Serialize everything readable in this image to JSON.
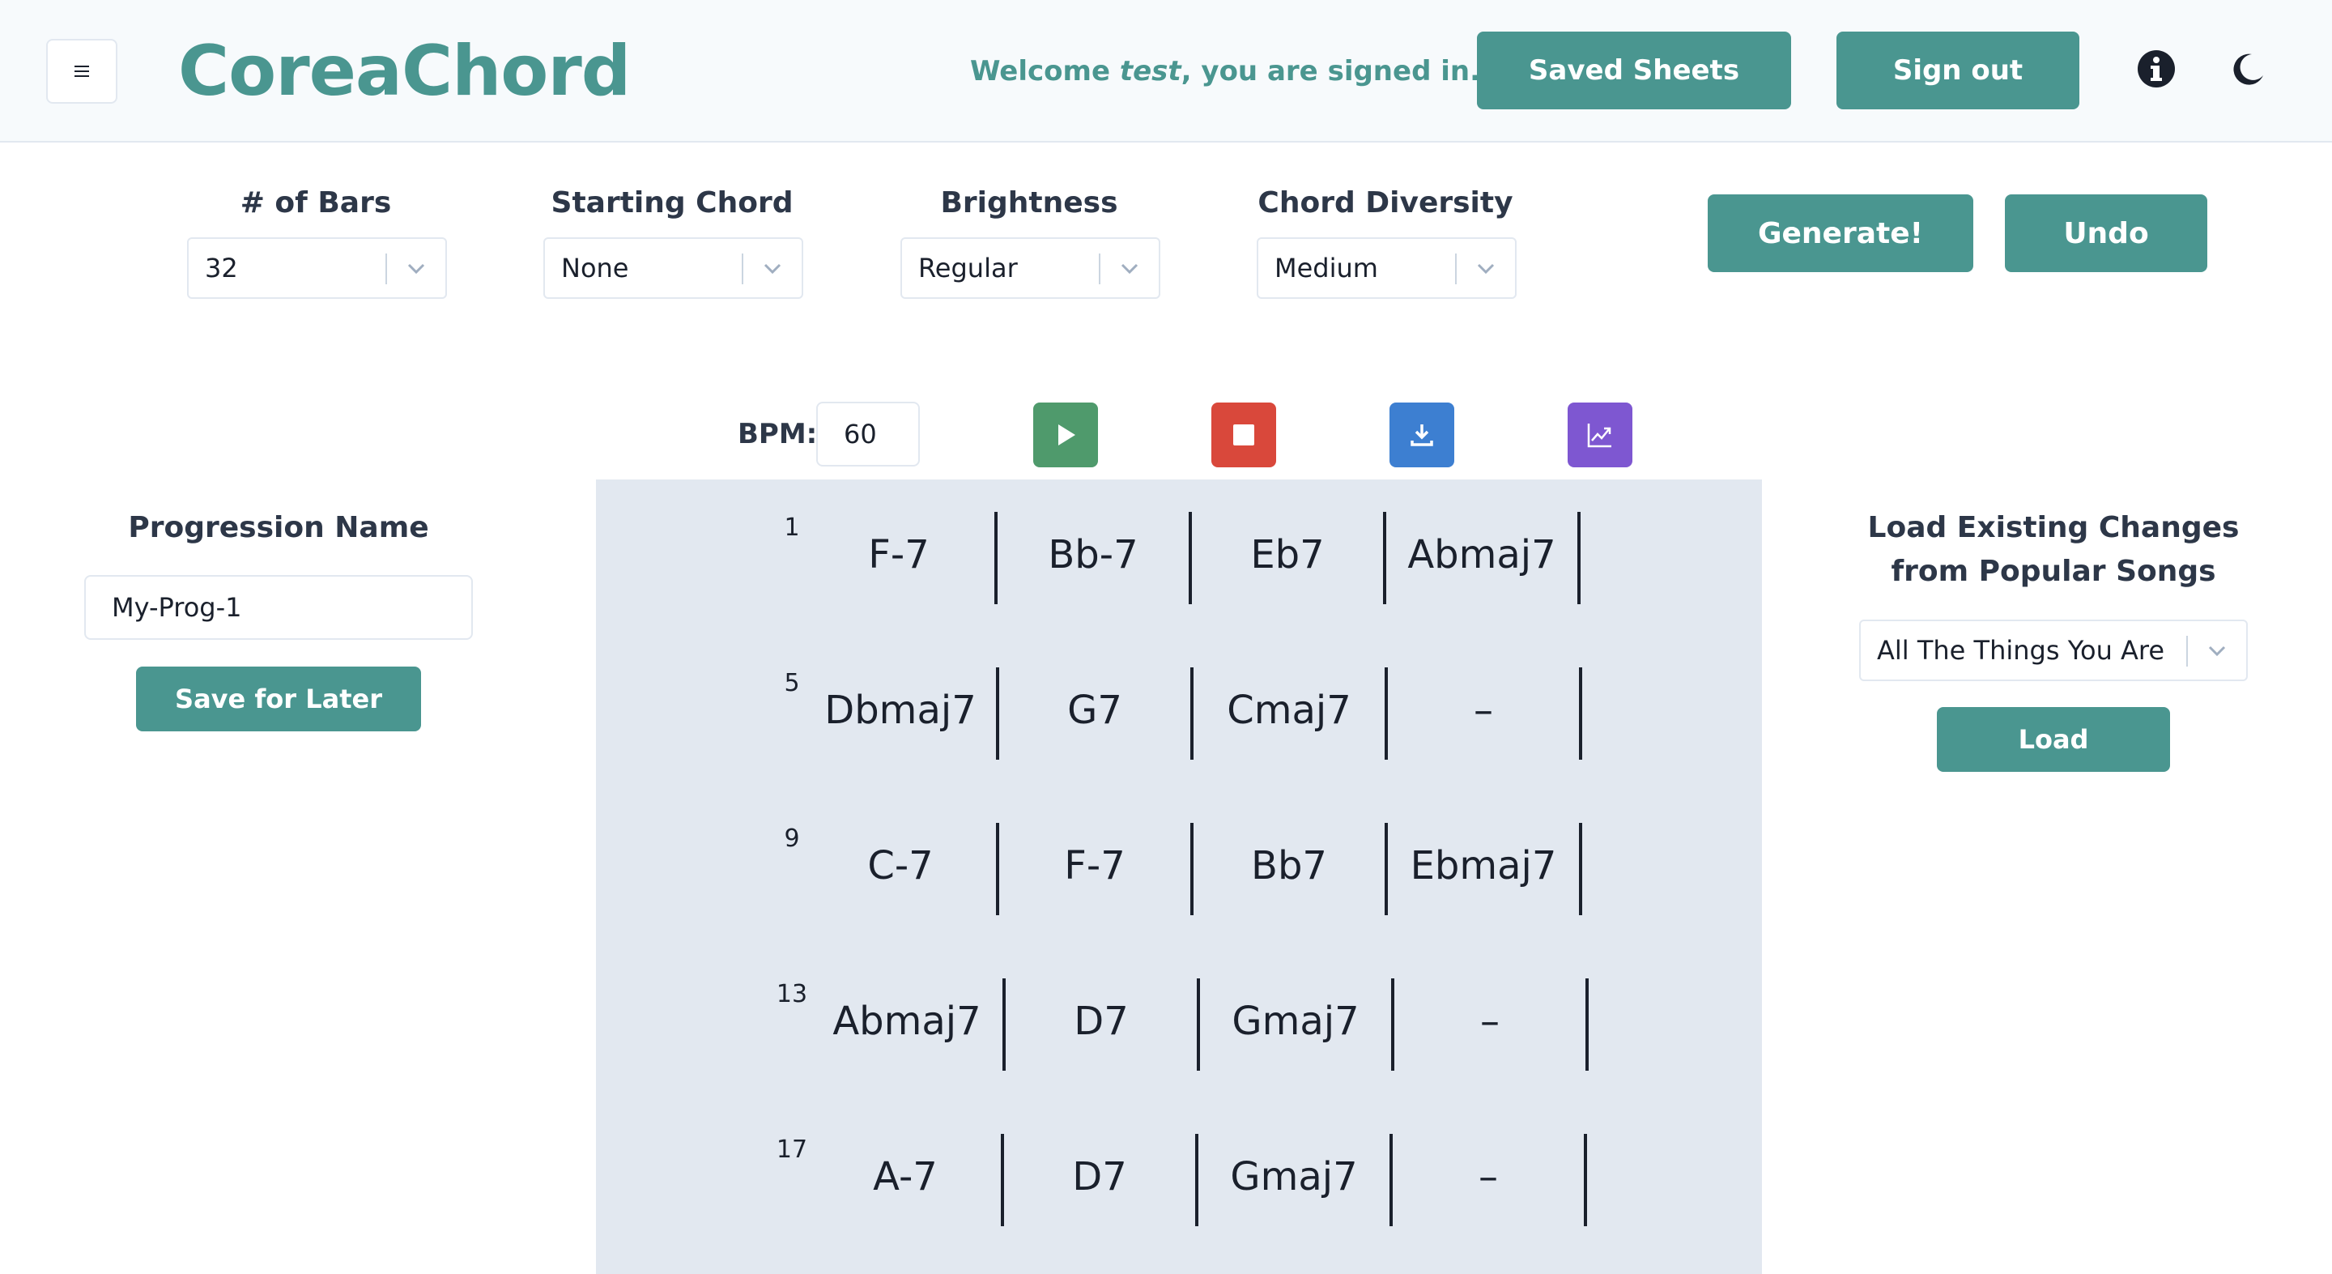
{
  "header": {
    "logo": "CoreaChord",
    "welcome_prefix": "Welcome ",
    "welcome_user": "test",
    "welcome_suffix": ", you are signed in.",
    "saved_sheets": "Saved Sheets",
    "sign_out": "Sign out"
  },
  "controls": {
    "bars_label": "# of Bars",
    "bars_value": "32",
    "starting_label": "Starting Chord",
    "starting_value": "None",
    "brightness_label": "Brightness",
    "brightness_value": "Regular",
    "diversity_label": "Chord Diversity",
    "diversity_value": "Medium",
    "generate": "Generate!",
    "undo": "Undo"
  },
  "transport": {
    "bpm_label": "BPM:",
    "bpm_value": "60"
  },
  "left": {
    "progression_label": "Progression Name",
    "progression_value": "My-Prog-1",
    "save": "Save for Later"
  },
  "right": {
    "load_label_1": "Load Existing Changes",
    "load_label_2": "from Popular Songs",
    "song_value": "All The Things You Are",
    "load": "Load"
  },
  "sheet": {
    "rows": [
      {
        "bar": "1",
        "chords": [
          "F-7",
          "Bb-7",
          "Eb7",
          "Abmaj7"
        ]
      },
      {
        "bar": "5",
        "chords": [
          "Dbmaj7",
          "G7",
          "Cmaj7",
          "–"
        ]
      },
      {
        "bar": "9",
        "chords": [
          "C-7",
          "F-7",
          "Bb7",
          "Ebmaj7"
        ]
      },
      {
        "bar": "13",
        "chords": [
          "Abmaj7",
          "D7",
          "Gmaj7",
          "–"
        ]
      },
      {
        "bar": "17",
        "chords": [
          "A-7",
          "D7",
          "Gmaj7",
          "–"
        ]
      }
    ]
  },
  "colors": {
    "accent": "#4a9690",
    "play": "#4f9a6c",
    "stop": "#d9483b",
    "download": "#3d7fd1",
    "chart": "#7e57d1",
    "sheet_bg": "#e2e8f0"
  },
  "icons": {
    "menu": "hamburger-icon",
    "info": "info-icon",
    "theme": "moon-icon",
    "play": "play-icon",
    "stop": "stop-icon",
    "download": "download-icon",
    "chart": "chart-icon"
  }
}
